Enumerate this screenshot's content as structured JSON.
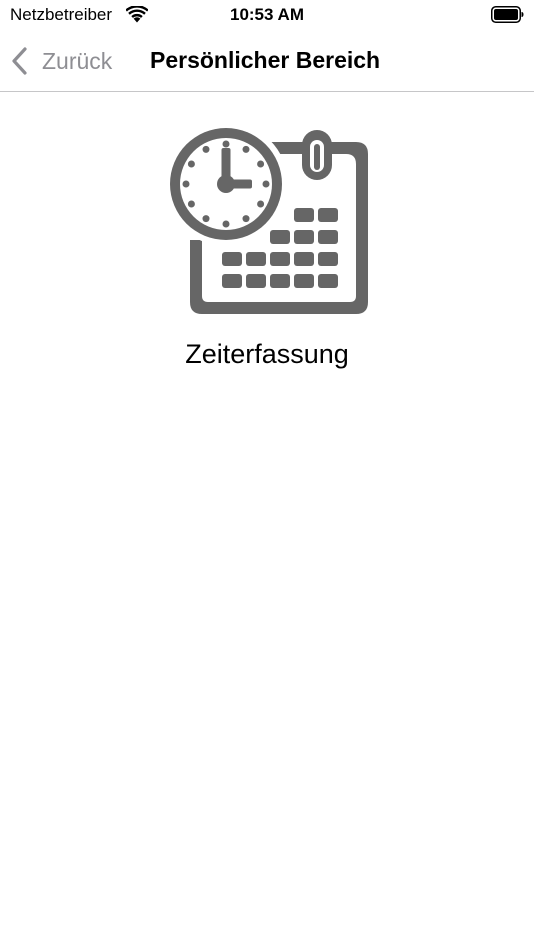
{
  "status_bar": {
    "carrier": "Netzbetreiber",
    "time": "10:53 AM",
    "wifi_icon": "wifi-icon",
    "battery_icon": "battery-icon"
  },
  "nav": {
    "back_label": "Zurück",
    "title": "Persönlicher Bereich",
    "back_icon": "chevron-left-icon"
  },
  "main": {
    "tiles": [
      {
        "label": "Zeiterfassung",
        "icon": "clock-calendar-icon"
      }
    ]
  },
  "colors": {
    "icon_gray": "#666666",
    "secondary_text": "#8e8e93",
    "separator": "#c6c6c8"
  }
}
